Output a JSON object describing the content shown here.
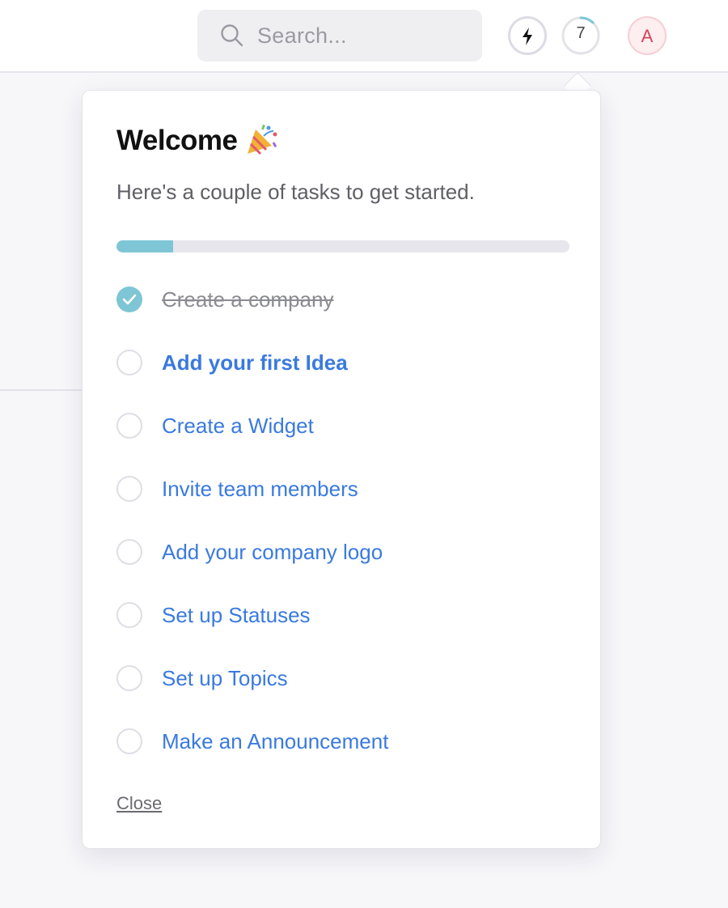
{
  "header": {
    "search_placeholder": "Search...",
    "notification_count": "7",
    "notification_progress": 0.12,
    "avatar_initial": "A"
  },
  "onboarding": {
    "title": "Welcome",
    "subtitle": "Here's a couple of tasks to get started.",
    "progress_fraction": 0.125,
    "progress_color": "#7ec6d6",
    "link_color": "#3a7adf",
    "tasks": [
      {
        "label": "Create a company",
        "done": true
      },
      {
        "label": "Add your first Idea",
        "done": false,
        "emphasized": true
      },
      {
        "label": "Create a Widget",
        "done": false
      },
      {
        "label": "Invite team members",
        "done": false
      },
      {
        "label": "Add your company logo",
        "done": false
      },
      {
        "label": "Set up Statuses",
        "done": false
      },
      {
        "label": "Set up Topics",
        "done": false
      },
      {
        "label": "Make an Announcement",
        "done": false
      }
    ],
    "close_label": "Close"
  }
}
